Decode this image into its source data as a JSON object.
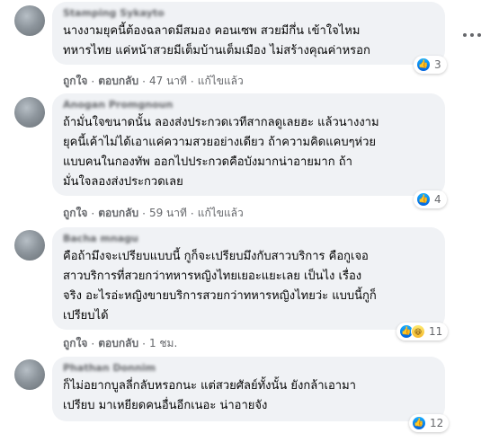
{
  "comments": [
    {
      "author": "Stamping Sykayto",
      "text": "นางงามยุคนี้ต้องฉลาดมีสมอง คอนเซพ สวยมีกึ่น เข้าใจไหม\nทหารไทย แค่หน้าสวยมีเต็มบ้านเต็มเมือง ไม่สร้างคุณค่าหรอก",
      "like": "ถูกใจ",
      "reply": "ตอบกลับ",
      "time": "47 นาที",
      "edited": "แก้ไขแล้ว",
      "reaction_count": "3",
      "reaction_types": [
        "like"
      ]
    },
    {
      "author": "Anogan Promgnoun",
      "text": "ถ้ามั่นใจขนาดนั้น ลองส่งประกวดเวทีสากลดูเลยฮะ แล้วนางงาม\nยุคนี้เค้าไม่ได้เอาแค่ความสวยอย่างเดียว ถ้าความคิดแคบๆห่วย\nแบบคนในกองทัพ ออกไปประกวดคือบังมากน่าอายมาก ถ้า\nมั่นใจลองส่งประกวดเลย",
      "like": "ถูกใจ",
      "reply": "ตอบกลับ",
      "time": "59 นาที",
      "edited": "แก้ไขแล้ว",
      "reaction_count": "4",
      "reaction_types": [
        "like"
      ]
    },
    {
      "author": "Bacha mnagu",
      "text": "คือถ้ามึงจะเปรียบแบบนี้ กูก็จะเปรียบมึงกับสาวบริการ คือกูเจอ\nสาวบริการที่สวยกว่าทหารหญิงไทยเยอะแยะเลย เป็นไง เรื่อง\nจริง อะไรอ่ะหญิงขายบริการสวยกว่าทหารหญิงไทยว่ะ แบบนี้กูก็\nเปรียบได้",
      "like": "ถูกใจ",
      "reply": "ตอบกลับ",
      "time": "1 ชม.",
      "edited": "",
      "reaction_count": "11",
      "reaction_types": [
        "like",
        "haha"
      ]
    },
    {
      "author": "Phathan Donnim",
      "text": "ก็ไม่อยากบูลลี่กลับหรอกนะ แต่สวยศัลย์ทั้งนั้น ยังกล้าเอามา\nเปรียบ มาเหยียดคนอื่นอีกเนอะ น่าอายจัง",
      "like": "",
      "reply": "",
      "time": "",
      "edited": "",
      "reaction_count": "12",
      "reaction_types": [
        "like"
      ]
    }
  ],
  "icons": {
    "like": "thumbs-up-icon",
    "haha": "haha-icon",
    "more": "more-options-icon"
  },
  "colors": {
    "bubble": "#f0f2f5",
    "meta": "#65676b",
    "like_blue": "#1877f2"
  }
}
